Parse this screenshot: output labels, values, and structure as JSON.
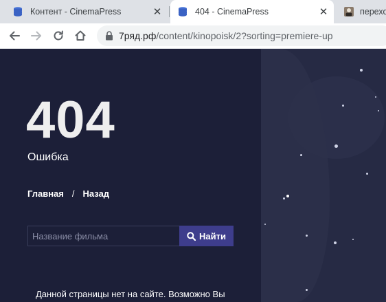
{
  "browser": {
    "tabs": [
      {
        "title": "Контент - CinemaPress",
        "favicon": "cinemapress-db-icon",
        "active": false
      },
      {
        "title": "404 - CinemaPress",
        "favicon": "cinemapress-db-icon",
        "active": true
      },
      {
        "title": "переход",
        "favicon": "avatar-icon",
        "active": false
      }
    ],
    "url_host": "7ряд.рф",
    "url_path": "/content/kinopoisk/2?sorting=premiere-up"
  },
  "page": {
    "code": "404",
    "error_label": "Ошибка",
    "nav": {
      "home": "Главная",
      "separator": "/",
      "back": "Назад"
    },
    "search": {
      "placeholder": "Название фильма",
      "value": "",
      "button": "Найти"
    },
    "notice": "Данной страницы нет на сайте. Возможно Вы"
  },
  "colors": {
    "background": "#1c1f38",
    "button": "#3e3d8c",
    "text": "#ffffff"
  }
}
